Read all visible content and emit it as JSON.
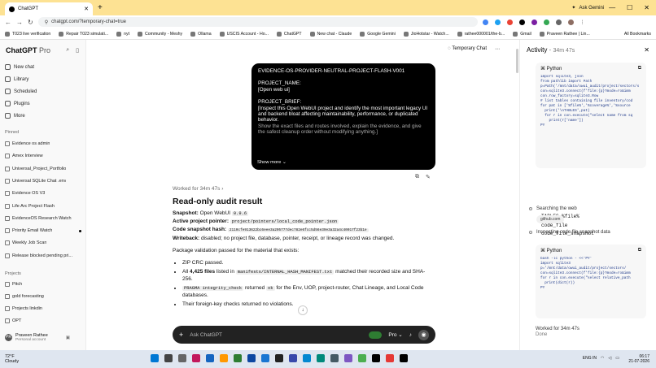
{
  "browser": {
    "tab_title": "ChatGPT",
    "ask_gemini": "Ask Gemini",
    "url": "chatgpt.com/?temporary-chat=true",
    "bookmarks": [
      "T023 live verification",
      "Repair T023 simulati...",
      "nyt",
      "Community - Meshy",
      "Ollama",
      "USCIS Account - Ho...",
      "ChatGPT",
      "New chat - Claude",
      "Google Gemini",
      "JioHotstar - Watch...",
      "rathee000001/the-b...",
      "Gmail",
      "Praveen Rathee | Lin..."
    ],
    "all_bookmarks": "All Bookmarks"
  },
  "sidebar": {
    "brand": "ChatGPT",
    "brand_plan": "Pro",
    "nav": [
      "New chat",
      "Library",
      "Scheduled",
      "Plugins",
      "More"
    ],
    "pinned_label": "Pinned",
    "pinned": [
      "Evidence os admin",
      "Amex Interview",
      "Universal_Project_Portfolio",
      "Universal SQLite Chat .env",
      "Evidence OS V3",
      "Life Arc Project Flash",
      "EvidenceOS Research Watch",
      "Priority Email Watch",
      "Weekly Job Scan",
      "Release blocked pending pri..."
    ],
    "projects_label": "Projects",
    "projects": [
      "Pitch",
      "gold forecasting",
      "Projects linkdin",
      "OPT"
    ],
    "user_name": "Praveen Rathee",
    "user_plan": "Personal account",
    "avatar": "PR"
  },
  "main": {
    "temporary_chat": "Temporary Chat",
    "user_message": {
      "id_line": "EVIDENCE-OS-PROVIDER-NEUTRAL-PROJECT-FLASH-V001",
      "project_name_label": "PROJECT_NAME:",
      "project_name": "[Open web ui]",
      "brief_label": "PROJECT_BRIEF:",
      "brief": "[Inspect this Open WebUI project and identify the most important legacy UI and backend bloat affecting maintainability, performance, or duplicated behavior.",
      "brief2": "Show the exact files and routes involved, explain the evidence, and give the safest cleanup order without modifying anything.]",
      "show_more": "Show more"
    },
    "worked_for": "Worked for 34m 47s",
    "answer": {
      "title": "Read-only audit result",
      "snapshot_label": "Snapshot:",
      "snapshot": "Open WebUI",
      "snapshot_version": "0.9.6",
      "pointer_label": "Active project pointer:",
      "pointer": "project/pointers/local_code_pointer.json",
      "hash_label": "Code snapshot hash:",
      "hash": "2110cfe913622bc6eee3a205777dec782e6fcc5d56e39e3a32a4c40017f23b1e",
      "writeback_label": "Writeback:",
      "writeback": "disabled; no project file, database, pointer, receipt, or lineage record was changed.",
      "validation": "Package validation passed for the material that exists:",
      "b1": "ZIP CRC passed.",
      "b2_pre": "All",
      "b2_count": "4,425 files",
      "b2_mid": "listed in",
      "b2_code": "manifests/INTERNAL_HASH_MANIFEST.txt",
      "b2_post": "matched their recorded size and SHA-256.",
      "b3_code": "PRAGMA integrity_check",
      "b3_mid": "returned",
      "b3_ok": "ok",
      "b3_post": "for the Env, UOP, project-router, Chat Lineage, and Local Code databases.",
      "b4": "Their foreign-key checks returned no violations."
    },
    "composer_placeholder": "Ask ChatGPT",
    "composer_model": "Pro"
  },
  "activity": {
    "title": "Activity",
    "duration": "34m 47s",
    "code1_lang": "Python",
    "code1": "import sqlite3, json\nfrom pathlib import Path\np=Path('/mnt/data/owui_audit/project/sectors/s\ncon=sqlite3.connect(f'file:{p}?mode=ro&imm\ncon.row_factory=sqlite3.Row\n# list tables containing file inventory/cod\nfor pat in ['%file%','%coverage%','%source\n  print('\\nTABLES',pat)\n  for r in con.execute(\"select name from sq\n    print(r['name'])\nPY",
    "tables": [
      "TABLES %file%",
      "code_file",
      "code_file_snapshot"
    ],
    "step1": "Searching the web",
    "step1_chip": "github.com",
    "step2": "Inspecting code file snapshot data",
    "code2_lang": "Python",
    "code2": "bash -lc python - <<'PY'\nimport sqlite3\np='/mnt/data/owui_audit/project/sectors/\ncon=sqlite3.connect(f'file:{p}?mode=ro&imm\nfor r in con.execute(\"select relative_path\n  print(dict(r))\nPY",
    "done_label": "Worked for 34m 47s",
    "done": "Done"
  },
  "taskbar": {
    "temp": "72°F",
    "weather": "Cloudy",
    "time": "06:17",
    "date": "21-07-2026",
    "lang": "ENG IN"
  }
}
